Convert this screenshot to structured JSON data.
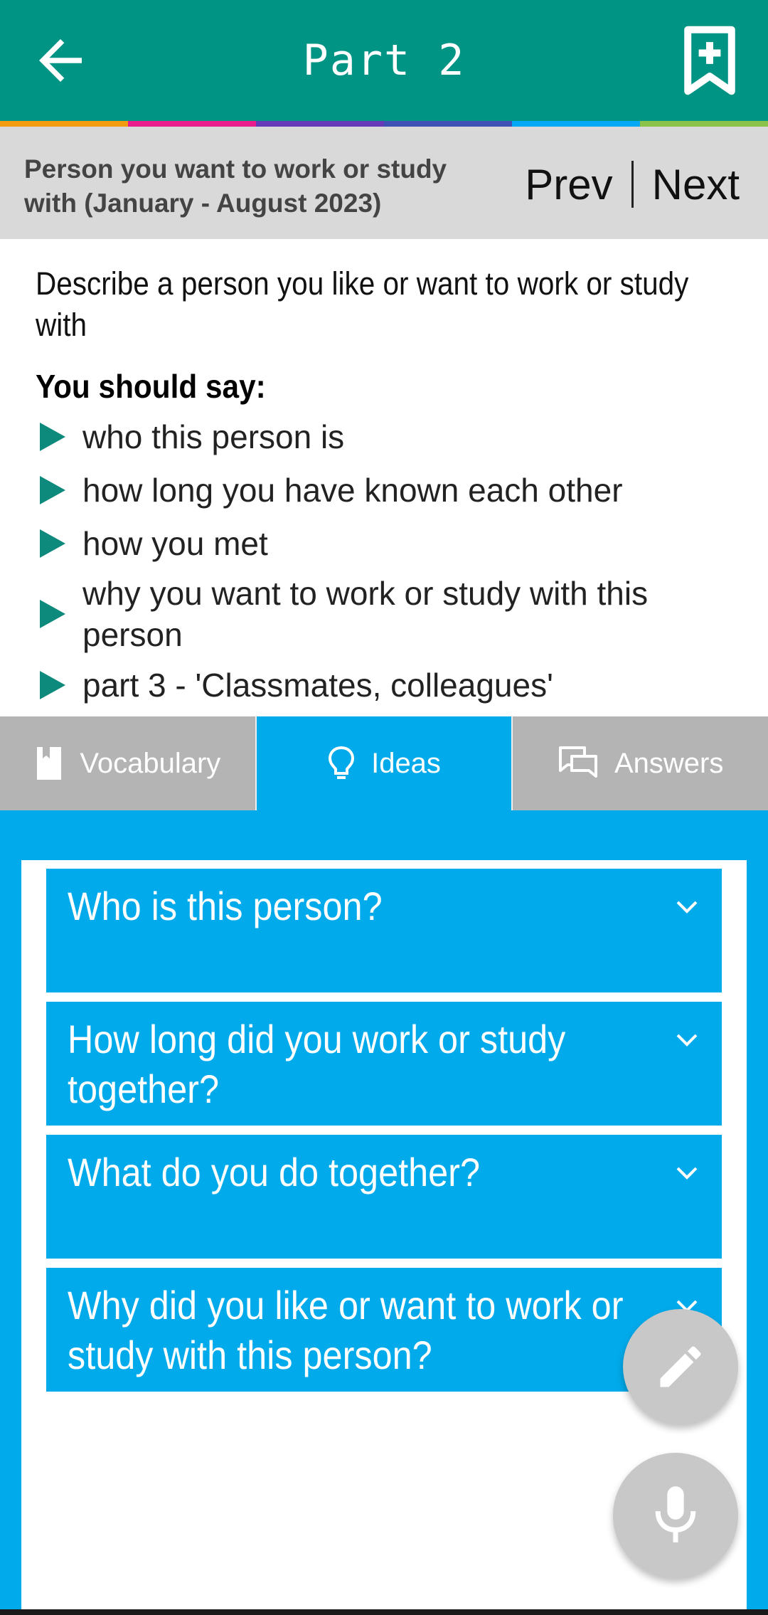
{
  "appbar": {
    "title": "Part 2",
    "back_icon": "arrow-back-icon",
    "bookmark_icon": "bookmark-add-icon",
    "color": "#009485",
    "stripe_colors": [
      "#f39c12",
      "#e91e8c",
      "#673ab7",
      "#3f51b5",
      "#03a9f4",
      "#8bc34a"
    ]
  },
  "topic": {
    "title": "Person you want to work or study with (January - August 2023)",
    "prev_label": "Prev",
    "next_label": "Next"
  },
  "cue_card": {
    "prompt": "Describe a person you like or want to work or study with",
    "should_say_label": "You should say:",
    "points": [
      "who this person is",
      "how long you have known each other",
      "how you met",
      "why you want to work or study with this person",
      "part 3 - 'Classmates, colleagues'"
    ]
  },
  "tabs": [
    {
      "label": "Vocabulary",
      "icon": "book-icon",
      "active": false
    },
    {
      "label": "Ideas",
      "icon": "lightbulb-icon",
      "active": true
    },
    {
      "label": "Answers",
      "icon": "chat-bubbles-icon",
      "active": false
    }
  ],
  "ideas": {
    "questions": [
      "Who is this person?",
      "How long did you work or study together?",
      "What do you do together?",
      "Why did you like or want to work or study with this person?"
    ]
  },
  "fabs": {
    "edit_icon": "pencil-icon",
    "mic_icon": "microphone-icon"
  },
  "colors": {
    "accent": "#00aaeb",
    "tab_inactive": "#b4b4b4",
    "bullet": "#0e8a7c"
  }
}
